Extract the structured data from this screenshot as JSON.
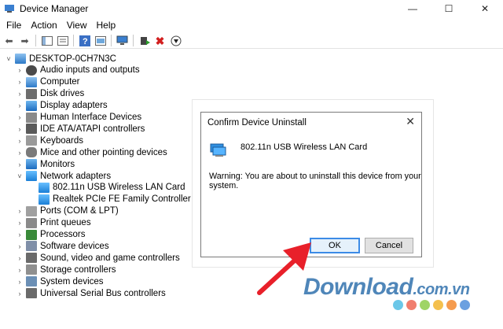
{
  "window": {
    "title": "Device Manager"
  },
  "menu": [
    "File",
    "Action",
    "View",
    "Help"
  ],
  "tree": {
    "root": "DESKTOP-0CH7N3C",
    "categories": [
      {
        "label": "Audio inputs and outputs",
        "icon": "audio-icon"
      },
      {
        "label": "Computer",
        "icon": "computer-icon"
      },
      {
        "label": "Disk drives",
        "icon": "disk-drive-icon"
      },
      {
        "label": "Display adapters",
        "icon": "display-adapter-icon"
      },
      {
        "label": "Human Interface Devices",
        "icon": "hid-icon"
      },
      {
        "label": "IDE ATA/ATAPI controllers",
        "icon": "ide-controller-icon"
      },
      {
        "label": "Keyboards",
        "icon": "keyboard-icon"
      },
      {
        "label": "Mice and other pointing devices",
        "icon": "mouse-icon"
      },
      {
        "label": "Monitors",
        "icon": "monitor-icon"
      },
      {
        "label": "Network adapters",
        "icon": "network-adapter-icon",
        "expanded": true,
        "children": [
          "802.11n USB Wireless LAN Card",
          "Realtek PCIe FE Family Controller"
        ]
      },
      {
        "label": "Ports (COM & LPT)",
        "icon": "port-icon"
      },
      {
        "label": "Print queues",
        "icon": "printer-icon"
      },
      {
        "label": "Processors",
        "icon": "processor-icon"
      },
      {
        "label": "Software devices",
        "icon": "software-device-icon"
      },
      {
        "label": "Sound, video and game controllers",
        "icon": "sound-icon"
      },
      {
        "label": "Storage controllers",
        "icon": "storage-icon"
      },
      {
        "label": "System devices",
        "icon": "system-device-icon"
      },
      {
        "label": "Universal Serial Bus controllers",
        "icon": "usb-icon"
      }
    ]
  },
  "dialog": {
    "title": "Confirm Device Uninstall",
    "device_name": "802.11n USB Wireless LAN Card",
    "warning": "Warning: You are about to uninstall this device from your system.",
    "ok_label": "OK",
    "cancel_label": "Cancel"
  },
  "watermark": {
    "brand": "Download",
    "suffix": ".com.vn"
  },
  "colors": {
    "accent": "#3c8be6",
    "arrow": "#e8202a",
    "watermark": "#4f86b9",
    "dots": [
      "#6bc7e8",
      "#f07e6e",
      "#9fd466",
      "#f4c04e",
      "#f59b4e",
      "#6ba0e0"
    ]
  }
}
